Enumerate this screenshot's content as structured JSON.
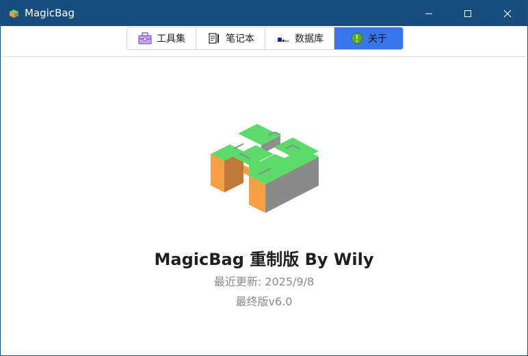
{
  "window": {
    "title": "MagicBag",
    "minimize_icon": "minimize-icon",
    "maximize_icon": "maximize-icon",
    "close_icon": "close-icon",
    "titlebar_color": "#174d7c"
  },
  "tabs": [
    {
      "label": "工具集",
      "icon": "toolbox-icon",
      "active": false
    },
    {
      "label": "笔记本",
      "icon": "notebook-icon",
      "active": false
    },
    {
      "label": "数据库",
      "icon": "database-icon",
      "active": false
    },
    {
      "label": "关于",
      "icon": "info-icon",
      "active": true
    }
  ],
  "accent_color": "#3a77ee",
  "about": {
    "logo_icon": "magicbag-logo-icon",
    "headline": "MagicBag 重制版 By Wily",
    "updated": "最近更新: 2025/9/8",
    "version": "最终版v6.0"
  }
}
